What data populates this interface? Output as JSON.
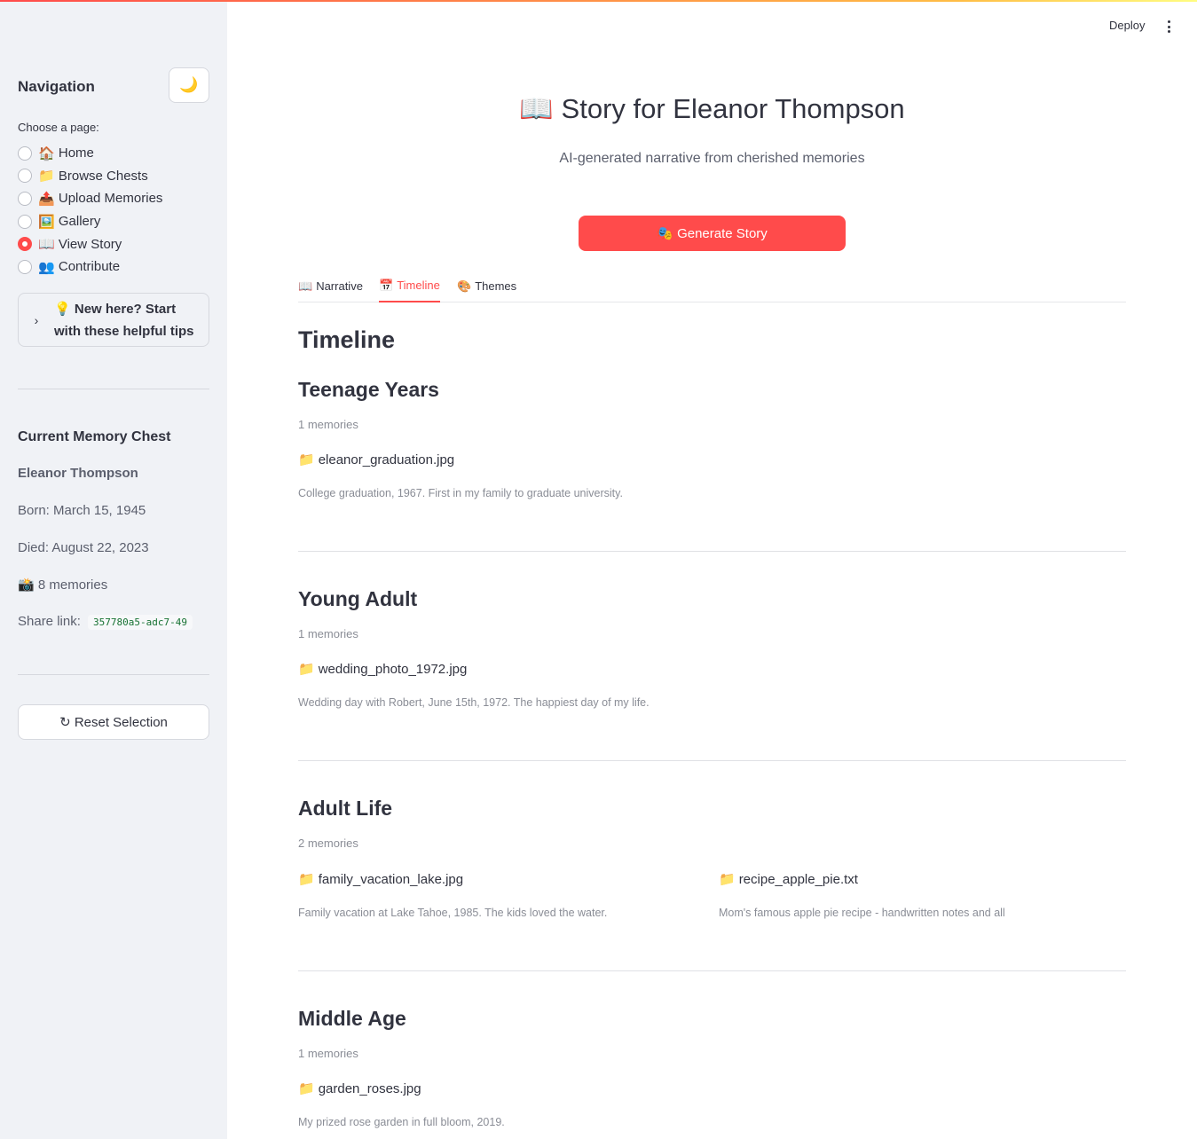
{
  "sidebar": {
    "title": "Navigation",
    "theme_icon": "🌙",
    "choose_label": "Choose a page:",
    "pages": [
      {
        "icon": "🏠",
        "label": "Home",
        "checked": false
      },
      {
        "icon": "📁",
        "label": "Browse Chests",
        "checked": false
      },
      {
        "icon": "📤",
        "label": "Upload Memories",
        "checked": false
      },
      {
        "icon": "🖼️",
        "label": "Gallery",
        "checked": false
      },
      {
        "icon": "📖",
        "label": "View Story",
        "checked": true
      },
      {
        "icon": "👥",
        "label": "Contribute",
        "checked": false
      }
    ],
    "tips": {
      "icon": "💡",
      "line1": "New here? Start",
      "line2": "with these helpful tips"
    },
    "chest": {
      "title": "Current Memory Chest",
      "name": "Eleanor Thompson",
      "born": "Born: March 15, 1945",
      "died": "Died: August 22, 2023",
      "memories_icon": "📸",
      "memories": "8 memories",
      "share_label": "Share link:",
      "share_code": "357780a5-adc7-49"
    },
    "reset_label": "↻ Reset Selection"
  },
  "toolbar": {
    "deploy": "Deploy"
  },
  "main": {
    "title_icon": "📖",
    "title": "Story for Eleanor Thompson",
    "subtitle": "AI-generated narrative from cherished memories",
    "generate_icon": "🎭",
    "generate_label": "Generate Story",
    "tabs": [
      {
        "icon": "📖",
        "label": "Narrative",
        "active": false
      },
      {
        "icon": "📅",
        "label": "Timeline",
        "active": true
      },
      {
        "icon": "🎨",
        "label": "Themes",
        "active": false
      }
    ],
    "timeline_heading": "Timeline",
    "folder_icon": "📁",
    "sections": [
      {
        "title": "Teenage Years",
        "count": "1 memories",
        "items": [
          {
            "name": "eleanor_graduation.jpg",
            "desc": "College graduation, 1967. First in my family to graduate university."
          }
        ]
      },
      {
        "title": "Young Adult",
        "count": "1 memories",
        "items": [
          {
            "name": "wedding_photo_1972.jpg",
            "desc": "Wedding day with Robert, June 15th, 1972. The happiest day of my life."
          }
        ]
      },
      {
        "title": "Adult Life",
        "count": "2 memories",
        "items": [
          {
            "name": "family_vacation_lake.jpg",
            "desc": "Family vacation at Lake Tahoe, 1985. The kids loved the water."
          },
          {
            "name": "recipe_apple_pie.txt",
            "desc": "Mom's famous apple pie recipe - handwritten notes and all"
          }
        ]
      },
      {
        "title": "Middle Age",
        "count": "1 memories",
        "items": [
          {
            "name": "garden_roses.jpg",
            "desc": "My prized rose garden in full bloom, 2019."
          }
        ]
      }
    ]
  },
  "colors": {
    "accent": "#ff4b4b",
    "sidebar_bg": "#f0f2f6",
    "text": "#31333f",
    "muted": "#8a8d96",
    "code": "#177233"
  }
}
